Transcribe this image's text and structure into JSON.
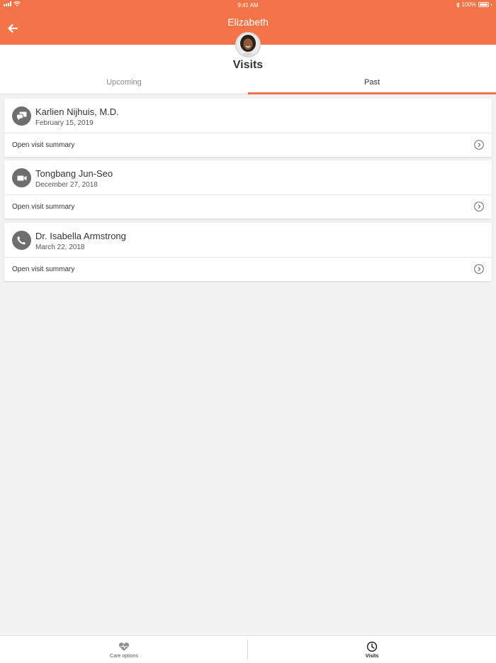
{
  "status_bar": {
    "time": "9:41 AM",
    "battery": "100%"
  },
  "header": {
    "title": "Elizabeth",
    "back_icon": "arrow-left-icon",
    "background": "#f47449"
  },
  "page": {
    "title": "Visits"
  },
  "tabs": [
    {
      "label": "Upcoming",
      "selected": false
    },
    {
      "label": "Past",
      "selected": true
    }
  ],
  "visits": [
    {
      "name": "Karlien Nijhuis, M.D.",
      "date": "February 15, 2019",
      "icon": "chat-icon",
      "link": "Open visit summary"
    },
    {
      "name": "Tongbang Jun-Seo",
      "date": "December 27, 2018",
      "icon": "video-icon",
      "link": "Open visit summary"
    },
    {
      "name": "Dr. Isabella Armstrong",
      "date": "March 22, 2018",
      "icon": "phone-icon",
      "link": "Open visit summary"
    }
  ],
  "tabbar": [
    {
      "label": "Care options",
      "icon": "heart-icon",
      "selected": false
    },
    {
      "label": "Visits",
      "icon": "clock-icon",
      "selected": true
    }
  ]
}
